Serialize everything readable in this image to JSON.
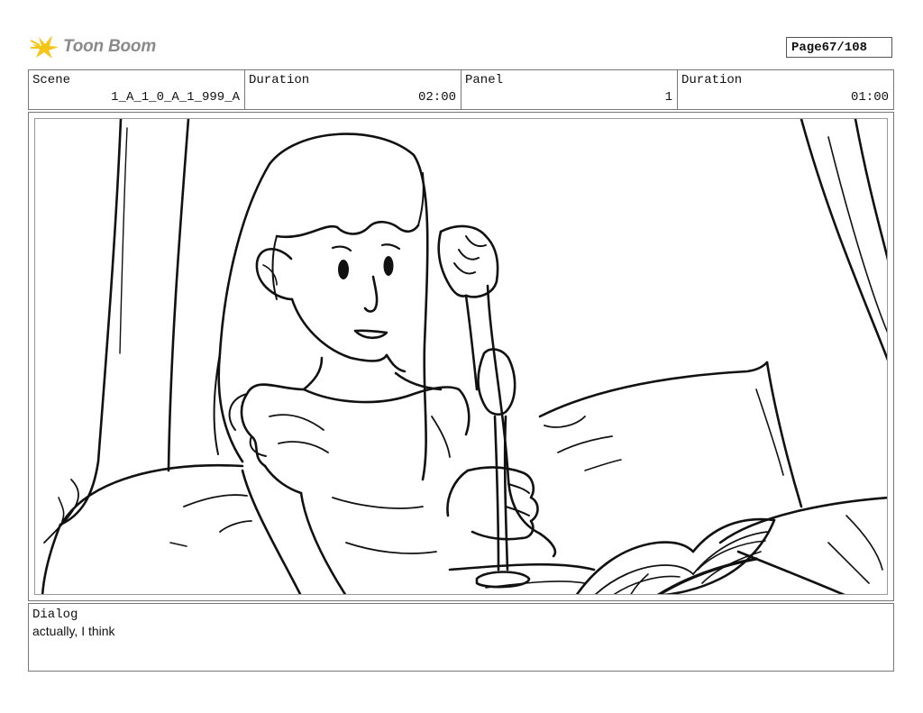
{
  "logo": {
    "text": "Toon Boom"
  },
  "page": {
    "label": "Page",
    "value": "67/108"
  },
  "info": {
    "scene_label": "Scene",
    "scene_value": "1_A_1_0_A_1_999_A",
    "duration_label": "Duration",
    "duration_value": "02:00",
    "panel_label": "Panel",
    "panel_value": "1",
    "panel_duration_label": "Duration",
    "panel_duration_value": "01:00"
  },
  "dialog": {
    "label": "Dialog",
    "text": "actually, I think"
  },
  "colors": {
    "logo_yellow": "#f5c518",
    "logo_text": "#8a8a8a",
    "ink": "#111111",
    "frame": "#777777"
  }
}
